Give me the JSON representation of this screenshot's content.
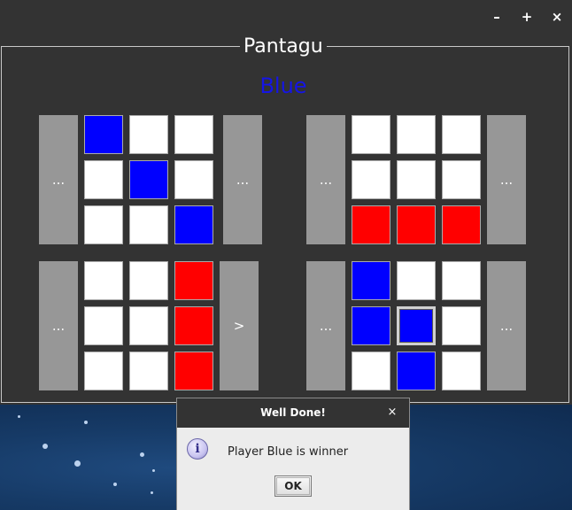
{
  "window": {
    "title": "Pantagu",
    "controls": {
      "minimize": "–",
      "maximize": "+",
      "close": "×"
    }
  },
  "game": {
    "current_player": "Blue",
    "boards": [
      {
        "id": "top-left",
        "left_button": "...",
        "right_button": "...",
        "cells": [
          "blue",
          "white",
          "white",
          "white",
          "blue",
          "white",
          "white",
          "white",
          "blue"
        ]
      },
      {
        "id": "top-right",
        "left_button": "...",
        "right_button": "...",
        "cells": [
          "white",
          "white",
          "white",
          "white",
          "white",
          "white",
          "red",
          "red",
          "red"
        ]
      },
      {
        "id": "bottom-left",
        "left_button": "...",
        "right_button": ">",
        "cells": [
          "white",
          "white",
          "red",
          "white",
          "white",
          "red",
          "white",
          "white",
          "red"
        ]
      },
      {
        "id": "bottom-right",
        "left_button": "...",
        "right_button": "...",
        "cells": [
          "blue",
          "white",
          "white",
          "blue",
          "blue",
          "white",
          "white",
          "blue",
          "white"
        ]
      }
    ],
    "colors": {
      "blue": "#0000ff",
      "red": "#ff0000",
      "white": "#ffffff",
      "panel": "#333333",
      "side_button": "#979797"
    }
  },
  "dialog": {
    "title": "Well Done!",
    "close": "×",
    "icon": "info-icon",
    "icon_glyph": "i",
    "message": "Player Blue is winner",
    "ok_label": "OK"
  }
}
